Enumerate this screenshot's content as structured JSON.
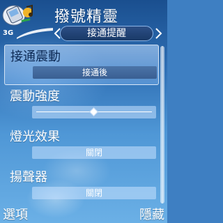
{
  "header": {
    "title": "撥號精靈",
    "tab_label": "接通提醒",
    "network": "3G"
  },
  "settings": [
    {
      "label": "接通震動",
      "value": "接通後",
      "type": "value",
      "selected": true
    },
    {
      "label": "震動強度",
      "type": "slider",
      "level": 0.5,
      "selected": false
    },
    {
      "label": "燈光效果",
      "value": "關閉",
      "type": "value",
      "selected": false
    },
    {
      "label": "揚聲器",
      "value": "關閉",
      "type": "value",
      "selected": false
    }
  ],
  "softkeys": {
    "left": "選項",
    "right": "隱藏"
  }
}
